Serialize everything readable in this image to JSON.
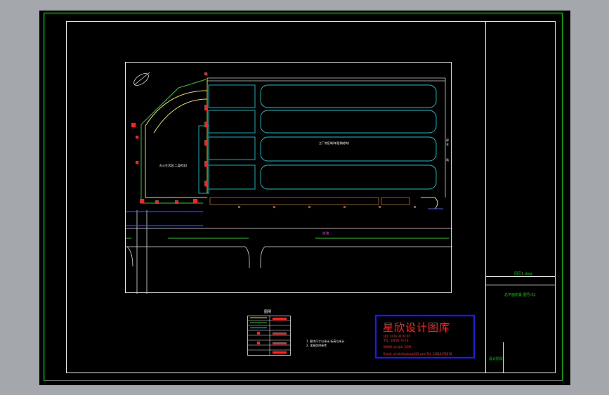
{
  "title_block": {
    "project_label": "园区1.dwg",
    "drawing_label": "总平面布置 图号:01",
    "designer_label": "设计阶段"
  },
  "drawing": {
    "building_label": "主厂房区域(单层钢结构)",
    "yard_label": "办公生活区(二层砖混)",
    "road_label": "道 路",
    "side_label_1": "停车",
    "side_label_2": "场"
  },
  "legend": {
    "title": "图例",
    "notes": [
      "1. 图中尺寸以米计,标高以米计",
      "2. 本图仅供参考"
    ]
  },
  "brand": {
    "title": "星欣设计图库",
    "line1": "QQ: 4026 06 04 45",
    "line2": "TEL: 18628 76 16",
    "site": "WWW. xinsjtk. COM",
    "contact": "Email: xinshejiquku@163.com  Tel: 13813476218"
  }
}
